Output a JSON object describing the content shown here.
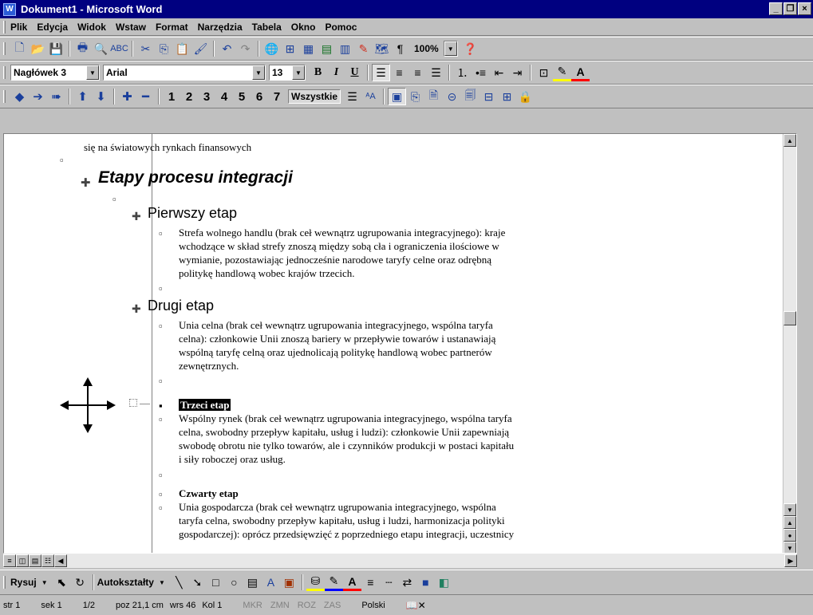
{
  "window": {
    "title": "Dokument1 - Microsoft Word",
    "icon_label": "W"
  },
  "menu": [
    "Plik",
    "Edycja",
    "Widok",
    "Wstaw",
    "Format",
    "Narzędzia",
    "Tabela",
    "Okno",
    "Pomoc"
  ],
  "toolbar_standard": {
    "zoom": "100%"
  },
  "toolbar_format": {
    "style": "Nagłówek 3",
    "font": "Arial",
    "size": "13",
    "bold": "B",
    "italic": "I",
    "underline": "U"
  },
  "toolbar_outline": {
    "levels": [
      "1",
      "2",
      "3",
      "4",
      "5",
      "6",
      "7"
    ],
    "all_label": "Wszystkie"
  },
  "document": {
    "line0": "się na światowych rynkach finansowych",
    "heading1": "Etapy procesu integracji",
    "sections": [
      {
        "title": "Pierwszy etap",
        "lines": [
          "Strefa wolnego handlu (brak ceł wewnątrz ugrupowania integracyjnego): kraje",
          "wchodzące w skład strefy znoszą między sobą cła i ograniczenia ilościowe w",
          "wymianie, pozostawiając jednocześnie narodowe taryfy celne oraz odrębną",
          "politykę handlową wobec krajów trzecich."
        ]
      },
      {
        "title": "Drugi etap",
        "lines": [
          "Unia celna (brak ceł wewnątrz ugrupowania integracyjnego, wspólna taryfa",
          "celna): członkowie Unii znoszą bariery w przepływie towarów i ustanawiają",
          "wspólną taryfę celną oraz ujednolicają politykę handlową wobec partnerów",
          "zewnętrznych."
        ]
      },
      {
        "title": "Trzeci etap",
        "lines": [
          "Wspólny rynek (brak ceł wewnątrz ugrupowania integracyjnego, wspólna taryfa",
          "celna, swobodny przepływ kapitału, usług i ludzi): członkowie Unii zapewniają",
          "swobodę obrotu nie tylko towarów, ale i czynników produkcji w postaci kapitału",
          "i siły roboczej oraz usług."
        ]
      },
      {
        "title": "Czwarty etap",
        "lines": [
          "Unia gospodarcza (brak ceł wewnątrz ugrupowania integracyjnego, wspólna",
          "taryfa celna, swobodny przepływ kapitału, usług i ludzi, harmonizacja polityki",
          "gospodarczej): oprócz przedsięwzięć z poprzedniego etapu integracji, uczestnicy"
        ]
      }
    ]
  },
  "drawing": {
    "draw_label": "Rysuj",
    "autoshapes_label": "Autokształty"
  },
  "status": {
    "page": "str 1",
    "section": "sek 1",
    "pages": "1/2",
    "position": "poz 21,1 cm",
    "line": "wrs 46",
    "column": "Kol 1",
    "rec": "MKR",
    "trk": "ZMN",
    "ext": "ROZ",
    "ovr": "ZAS",
    "language": "Polski"
  }
}
